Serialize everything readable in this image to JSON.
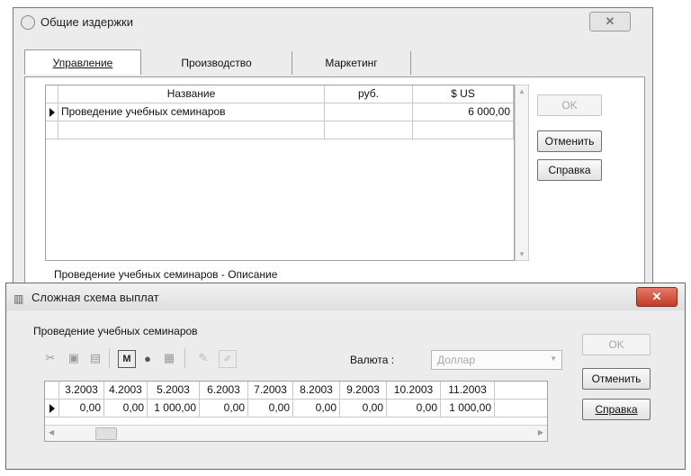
{
  "costs_window": {
    "title": "Общие издержки",
    "tabs": [
      {
        "label": "Управление",
        "active": true
      },
      {
        "label": "Производство",
        "active": false
      },
      {
        "label": "Маркетинг",
        "active": false
      }
    ],
    "columns": [
      "Название",
      "руб.",
      "$ US"
    ],
    "rows": [
      {
        "name": "Проведение учебных семинаров",
        "rub": "",
        "usd": "6 000,00"
      }
    ],
    "description_label": "Проведение учебных семинаров - Описание",
    "buttons": {
      "ok": "OK",
      "cancel": "Отменить",
      "help": "Справка"
    }
  },
  "payment_window": {
    "title": "Сложная схема выплат",
    "item_label": "Проведение учебных семинаров",
    "currency_label": "Валюта :",
    "currency_value": "Доллар",
    "toolbar_icons": [
      "cut-icon",
      "copy-icon",
      "paste-icon",
      "calculator-icon",
      "database-icon",
      "image-icon",
      "pencil-icon",
      "edit-icon"
    ],
    "periods": [
      "3.2003",
      "4.2003",
      "5.2003",
      "6.2003",
      "7.2003",
      "8.2003",
      "9.2003",
      "10.2003",
      "11.2003"
    ],
    "values": [
      "0,00",
      "0,00",
      "1 000,00",
      "0,00",
      "0,00",
      "0,00",
      "0,00",
      "0,00",
      "1 000,00"
    ],
    "buttons": {
      "ok": "OK",
      "cancel": "Отменить",
      "help": "Справка"
    }
  }
}
